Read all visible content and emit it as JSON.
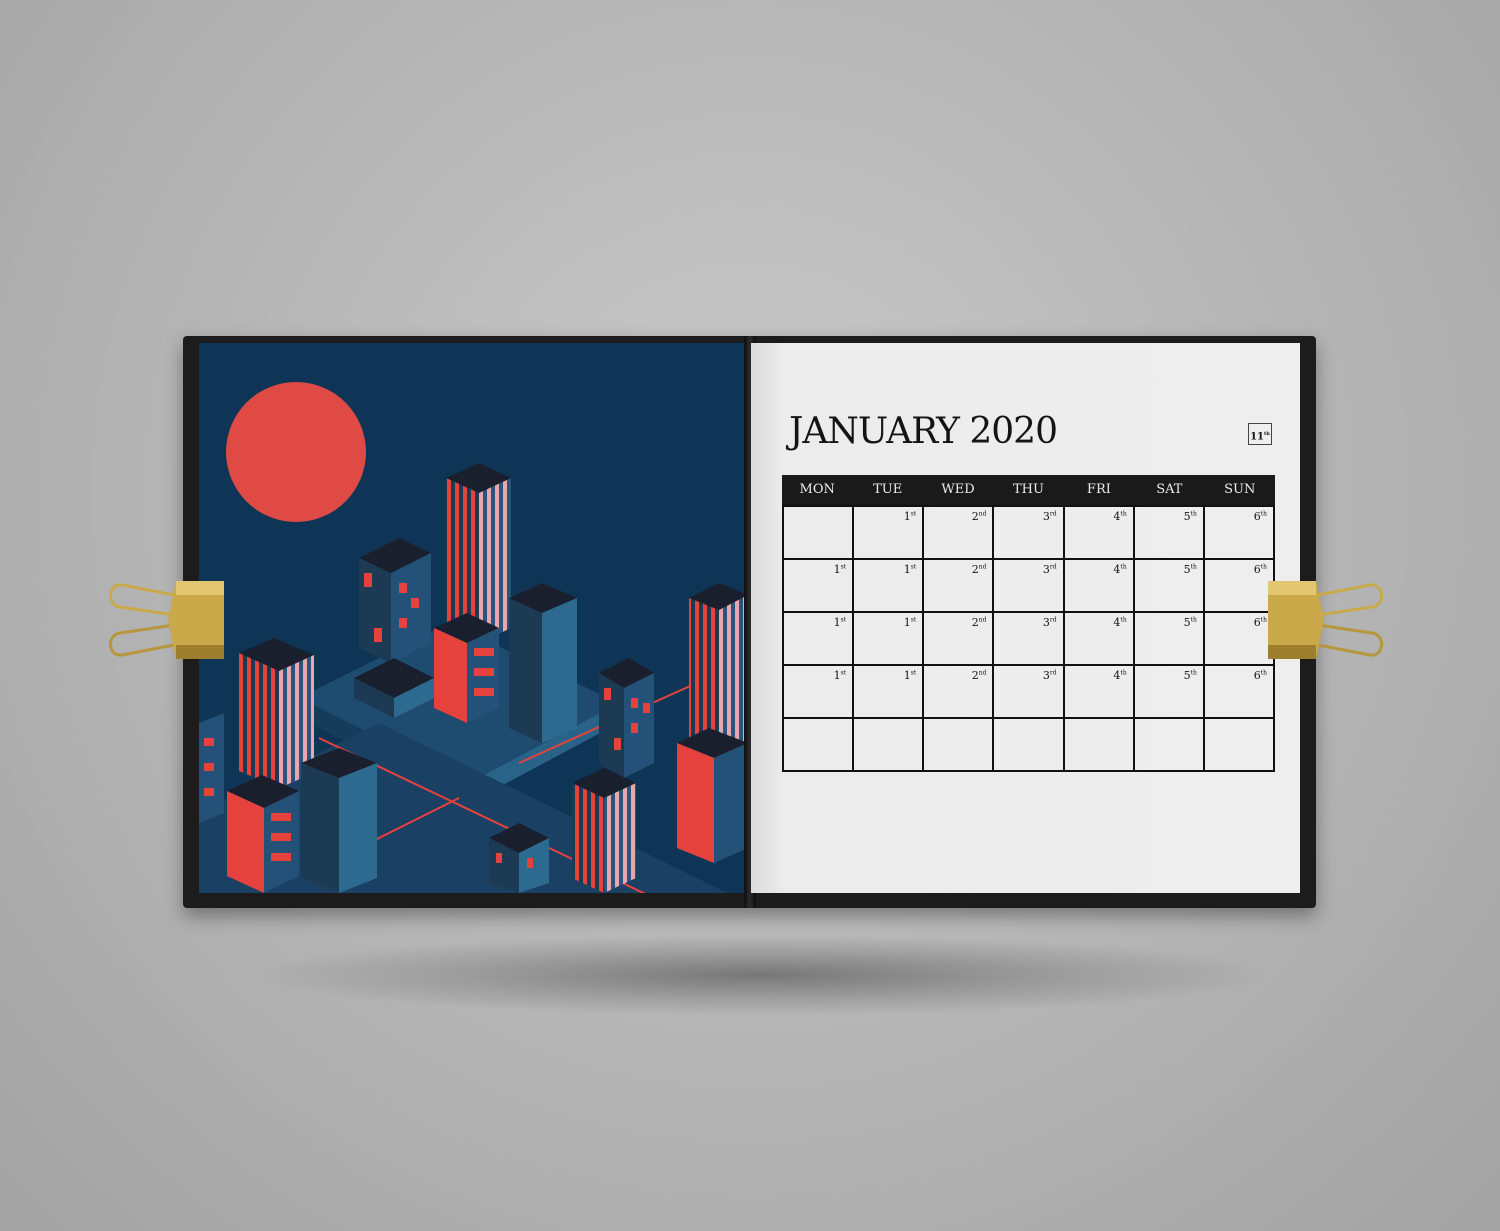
{
  "calendar": {
    "title": "JANUARY 2020",
    "page_badge": "11",
    "page_badge_suffix": "th",
    "weekdays": [
      "MON",
      "TUE",
      "WED",
      "THU",
      "FRI",
      "SAT",
      "SUN"
    ],
    "rows": [
      [
        {
          "n": "",
          "s": ""
        },
        {
          "n": "1",
          "s": "st"
        },
        {
          "n": "2",
          "s": "nd"
        },
        {
          "n": "3",
          "s": "rd"
        },
        {
          "n": "4",
          "s": "th"
        },
        {
          "n": "5",
          "s": "th"
        },
        {
          "n": "6",
          "s": "th"
        }
      ],
      [
        {
          "n": "1",
          "s": "st"
        },
        {
          "n": "1",
          "s": "st"
        },
        {
          "n": "2",
          "s": "nd"
        },
        {
          "n": "3",
          "s": "rd"
        },
        {
          "n": "4",
          "s": "th"
        },
        {
          "n": "5",
          "s": "th"
        },
        {
          "n": "6",
          "s": "th"
        }
      ],
      [
        {
          "n": "1",
          "s": "st"
        },
        {
          "n": "1",
          "s": "st"
        },
        {
          "n": "2",
          "s": "nd"
        },
        {
          "n": "3",
          "s": "rd"
        },
        {
          "n": "4",
          "s": "th"
        },
        {
          "n": "5",
          "s": "th"
        },
        {
          "n": "6",
          "s": "th"
        }
      ],
      [
        {
          "n": "1",
          "s": "st"
        },
        {
          "n": "1",
          "s": "st"
        },
        {
          "n": "2",
          "s": "nd"
        },
        {
          "n": "3",
          "s": "rd"
        },
        {
          "n": "4",
          "s": "th"
        },
        {
          "n": "5",
          "s": "th"
        },
        {
          "n": "6",
          "s": "th"
        }
      ],
      [
        {
          "n": "",
          "s": ""
        },
        {
          "n": "",
          "s": ""
        },
        {
          "n": "",
          "s": ""
        },
        {
          "n": "",
          "s": ""
        },
        {
          "n": "",
          "s": ""
        },
        {
          "n": "",
          "s": ""
        },
        {
          "n": "",
          "s": ""
        }
      ]
    ]
  },
  "illustration": {
    "name": "isometric-night-city",
    "colors": {
      "sky": "#0f3556",
      "sun": "#e04a45",
      "building_dark": "#1d3a55",
      "building_mid": "#245177",
      "building_light": "#2c6a8f",
      "accent_red": "#e5423e",
      "accent_pink": "#e9a7ad"
    }
  },
  "colors": {
    "background": "#b8b8b8",
    "cover": "#1c1c1c",
    "page": "#eeeeee",
    "header_bar": "#1a1a1a",
    "clip_gold": "#c9a94a"
  }
}
